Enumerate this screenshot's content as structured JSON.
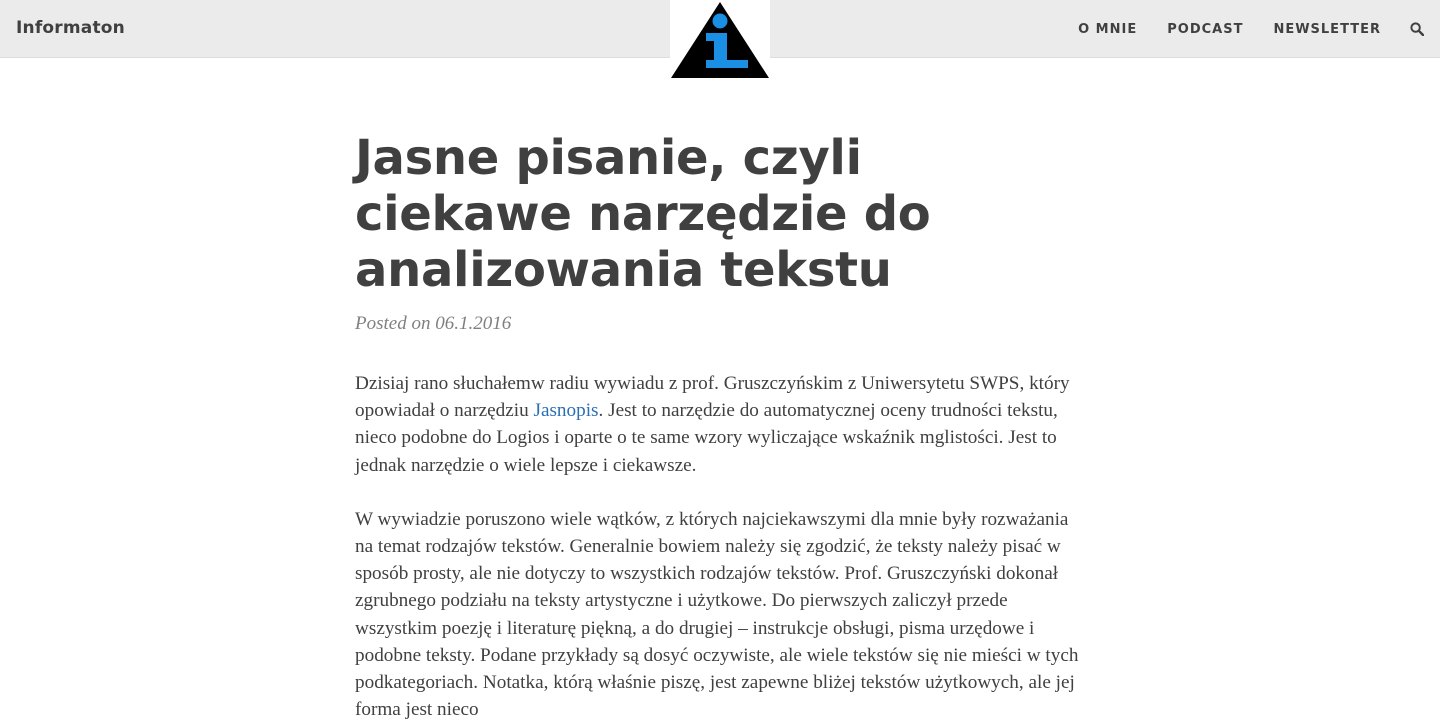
{
  "site": {
    "title": "Informaton",
    "logo": "info-triangle-logo"
  },
  "nav": {
    "items": [
      {
        "label": "O MNIE"
      },
      {
        "label": "PODCAST"
      },
      {
        "label": "NEWSLETTER"
      }
    ],
    "search_icon": "search-icon"
  },
  "post": {
    "title": "Jasne pisanie, czyli ciekawe narzędzie do analizowania tekstu",
    "meta": "Posted on 06.1.2016",
    "p1_before": "Dzisiaj rano słuchałemw radiu wywiadu z prof. Gruszczyńskim z Uniwersytetu SWPS, który opowiadał o narzędziu ",
    "p1_link": "Jasnopis",
    "p1_after": ". Jest to narzędzie do automatycznej oceny trudności tekstu, nieco podobne do Logios i oparte o te same wzory wyliczające wskaźnik mglistości. Jest to jednak narzędzie o wiele lepsze i ciekawsze.",
    "p2": "W wywiadzie poruszono wiele wątków, z których najciekawszymi dla mnie były rozważania na temat rodzajów tekstów. Generalnie bowiem należy się zgodzić, że teksty należy pisać w sposób prosty, ale nie dotyczy to wszystkich rodzajów tekstów. Prof. Gruszczyński dokonał zgrubnego podziału na teksty artystyczne i użytkowe. Do pierwszych zaliczył przede wszystkim poezję i literaturę piękną, a do drugiej – instrukcje obsługi, pisma urzędowe i podobne teksty. Podane przykłady są dosyć oczywiste, ale wiele tekstów się nie mieści w tych podkategoriach. Notatka, którą właśnie piszę, jest zapewne bliżej tekstów użytkowych, ale jej forma jest nieco"
  },
  "colors": {
    "navbar_bg": "#ebebeb",
    "text": "#404040",
    "link": "#2a6fb5",
    "logo_blue": "#1a8fe3"
  }
}
